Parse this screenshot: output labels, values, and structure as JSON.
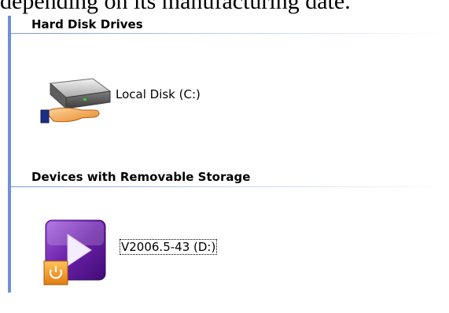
{
  "caption": "depending on its manufacturing date.",
  "groups": {
    "hard_disks": {
      "title": "Hard Disk Drives",
      "items": [
        {
          "label": "Local Disk (C:)",
          "icon": "shared-hard-disk-icon"
        }
      ]
    },
    "removable": {
      "title": "Devices with Removable Storage",
      "items": [
        {
          "label": "V2006.5-43 (D:)",
          "icon": "media-drive-icon"
        }
      ]
    }
  },
  "colors": {
    "rule": "#6f8fd8",
    "header_line": "#7a96df",
    "media_purple": "#6a1fa8",
    "media_orange": "#f29a1e"
  }
}
